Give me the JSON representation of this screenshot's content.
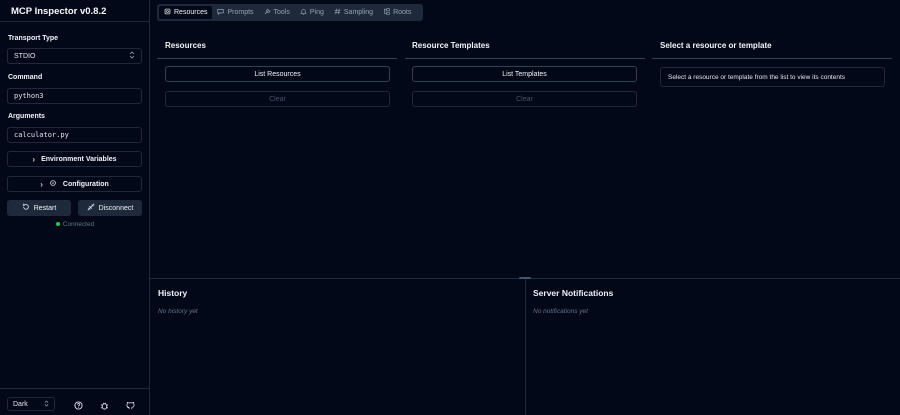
{
  "sidebar": {
    "title": "MCP Inspector v0.8.2",
    "transport_label": "Transport Type",
    "transport_value": "STDIO",
    "command_label": "Command",
    "command_value": "python3",
    "arguments_label": "Arguments",
    "arguments_value": "calculator.py",
    "env_vars_label": "Environment Variables",
    "config_label": "Configuration",
    "restart_label": "Restart",
    "disconnect_label": "Disconnect",
    "status": "Connected",
    "status_color": "#22c55e",
    "theme_value": "Dark"
  },
  "tabs": [
    {
      "label": "Resources",
      "icon": "resources-icon",
      "active": true
    },
    {
      "label": "Prompts",
      "icon": "prompts-icon",
      "active": false
    },
    {
      "label": "Tools",
      "icon": "tools-icon",
      "active": false
    },
    {
      "label": "Ping",
      "icon": "bell-icon",
      "active": false
    },
    {
      "label": "Sampling",
      "icon": "hash-icon",
      "active": false
    },
    {
      "label": "Roots",
      "icon": "folder-tree-icon",
      "active": false
    }
  ],
  "resources": {
    "title": "Resources",
    "list_button": "List Resources",
    "clear_button": "Clear"
  },
  "templates": {
    "title": "Resource Templates",
    "list_button": "List Templates",
    "clear_button": "Clear"
  },
  "detail": {
    "title": "Select a resource or template",
    "message": "Select a resource or template from the list to view its contents"
  },
  "history": {
    "title": "History",
    "empty": "No history yet"
  },
  "notifications": {
    "title": "Server Notifications",
    "empty": "No notifications yet"
  }
}
